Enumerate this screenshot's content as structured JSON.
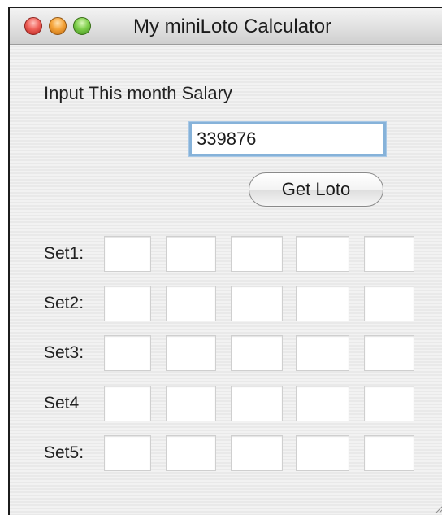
{
  "window": {
    "title": "My miniLoto Calculator",
    "traffic_lights": [
      "close-button",
      "minimize-button",
      "zoom-button"
    ]
  },
  "form": {
    "prompt_label": "Input This month Salary",
    "salary_value": "339876",
    "button_label": "Get Loto"
  },
  "sets": [
    {
      "label": "Set1:",
      "values": [
        "",
        "",
        "",
        "",
        ""
      ]
    },
    {
      "label": "Set2:",
      "values": [
        "",
        "",
        "",
        "",
        ""
      ]
    },
    {
      "label": "Set3:",
      "values": [
        "",
        "",
        "",
        "",
        ""
      ]
    },
    {
      "label": "Set4",
      "values": [
        "",
        "",
        "",
        "",
        ""
      ]
    },
    {
      "label": "Set5:",
      "values": [
        "",
        "",
        "",
        "",
        ""
      ]
    }
  ],
  "colors": {
    "focus_ring": "#86b2d9",
    "close": "#f0625a",
    "minimize": "#f5a43a",
    "zoom": "#7fcf4b"
  }
}
